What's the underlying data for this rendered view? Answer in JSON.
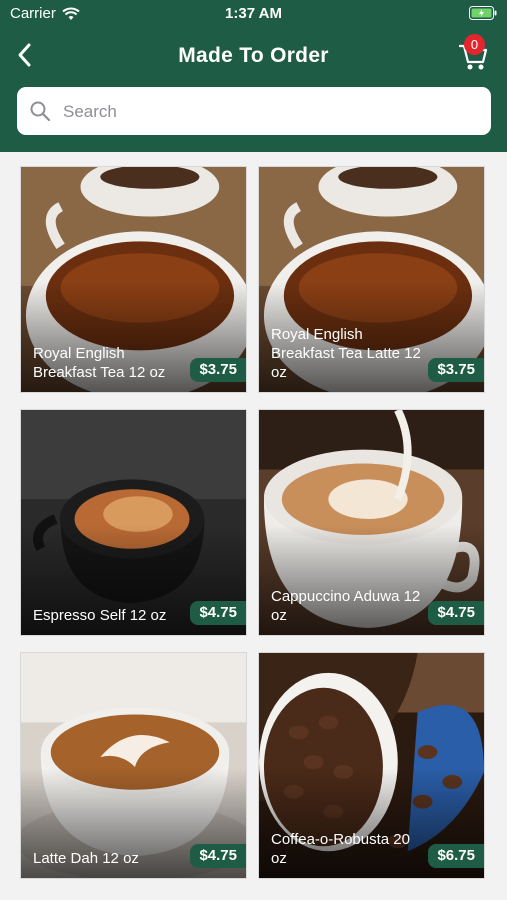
{
  "status": {
    "carrier": "Carrier",
    "time": "1:37 AM"
  },
  "nav": {
    "title": "Made To Order",
    "cart_count": "0"
  },
  "search": {
    "placeholder": "Search"
  },
  "products": [
    {
      "name": "Royal English Breakfast Tea 12 oz",
      "price": "$3.75",
      "icon": "tea-cup-image"
    },
    {
      "name": "Royal English Breakfast Tea Latte 12 oz",
      "price": "$3.75",
      "icon": "tea-cup-image"
    },
    {
      "name": "Espresso Self 12 oz",
      "price": "$4.75",
      "icon": "espresso-cup-image"
    },
    {
      "name": "Cappuccino Aduwa 12 oz",
      "price": "$4.75",
      "icon": "cappuccino-cup-image"
    },
    {
      "name": "Latte Dah 12 oz",
      "price": "$4.75",
      "icon": "latte-art-image"
    },
    {
      "name": "Coffea-o-Robusta 20 oz",
      "price": "$6.75",
      "icon": "coffee-beans-image"
    }
  ],
  "colors": {
    "header": "#1f5c46",
    "badge": "#e3262e",
    "price_tag": "#1f5c46"
  }
}
